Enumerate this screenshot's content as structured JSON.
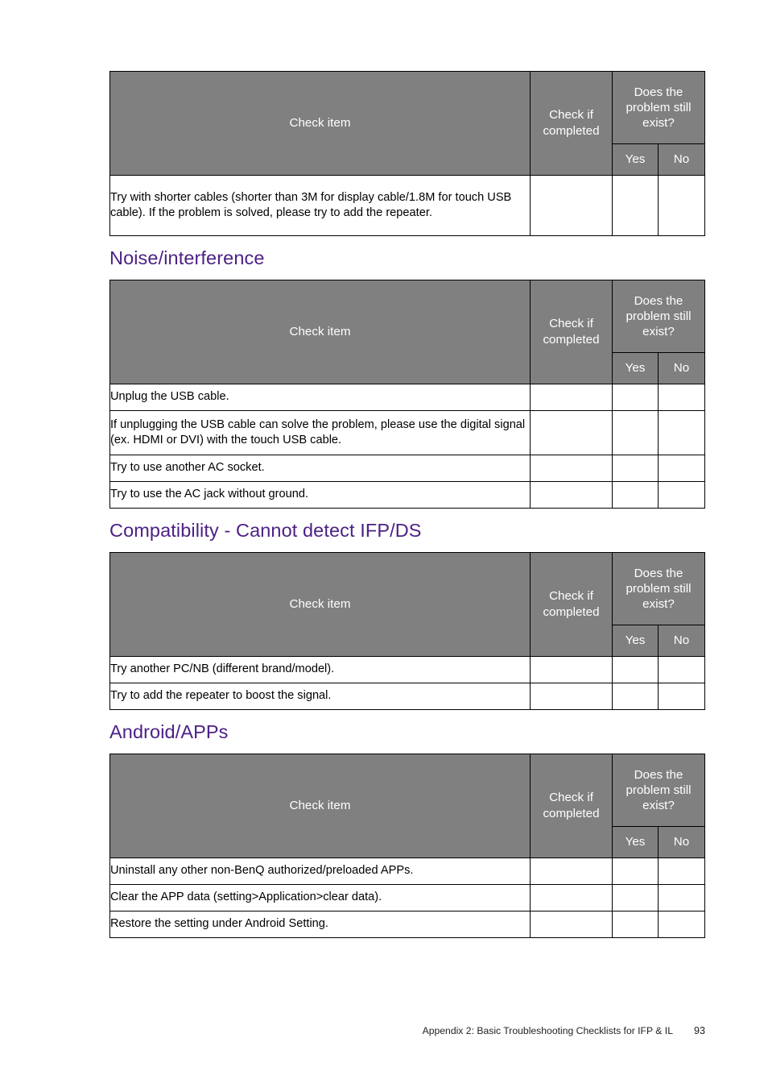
{
  "page": {
    "footer_text": "Appendix 2: Basic Troubleshooting Checklists for IFP & IL",
    "page_number": "93",
    "heading_color": "#4d2185",
    "header_fill_color": "#808080"
  },
  "table_headers": {
    "check_item": "Check item",
    "check_if_completed": "Check if completed",
    "does_problem_still_exist": "Does the problem still exist?",
    "yes": "Yes",
    "no": "No"
  },
  "sections": [
    {
      "heading": null,
      "rows": [
        "Try with shorter cables (shorter than 3M for display cable/1.8M for touch USB cable). If the problem is solved, please try to add the repeater."
      ]
    },
    {
      "heading": "Noise/interference",
      "rows": [
        "Unplug the USB cable.",
        "If unplugging the USB cable can solve the problem, please use the digital signal (ex. HDMI or DVI) with the touch USB cable.",
        "Try to use another AC socket.",
        "Try to use the AC jack without ground."
      ]
    },
    {
      "heading": "Compatibility - Cannot detect IFP/DS",
      "rows": [
        "Try another PC/NB (different brand/model).",
        "Try to add the repeater to boost the signal."
      ]
    },
    {
      "heading": "Android/APPs",
      "rows": [
        "Uninstall any other non-BenQ authorized/preloaded APPs.",
        "Clear the APP data (setting>Application>clear data).",
        "Restore the setting under Android Setting."
      ]
    }
  ]
}
